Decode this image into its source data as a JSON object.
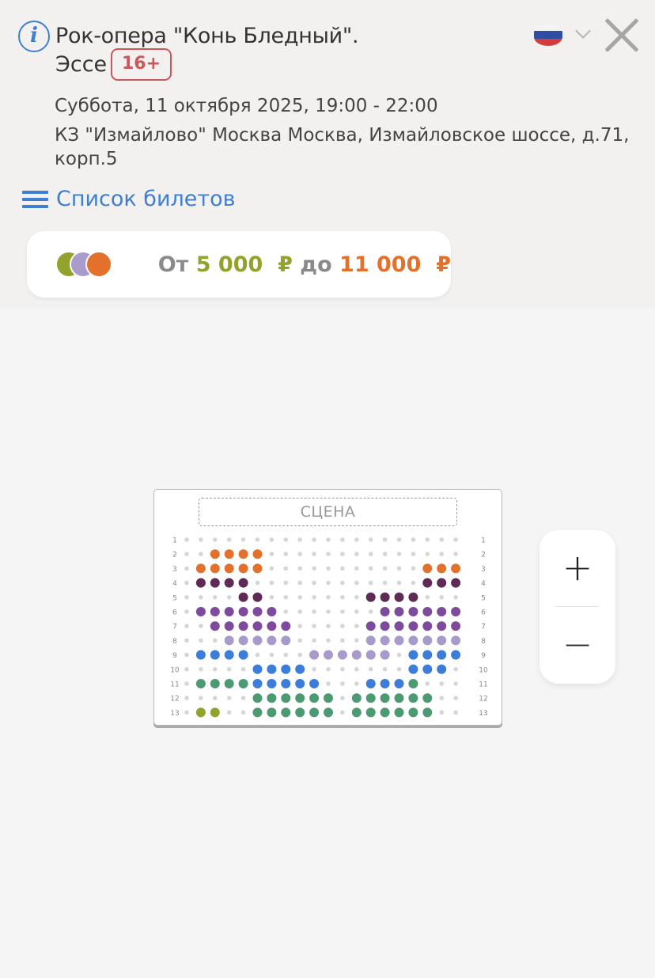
{
  "event": {
    "title_line1": "Рок-опера \"Конь Бледный\".",
    "title_line2": "Эссе",
    "age_rating": "16+",
    "datetime": "Суббота, 11 октября 2025, 19:00 - 22:00",
    "venue": "КЗ \"Измайлово\" Москва Москва, Измайловское шоссе, д.71, корп.5"
  },
  "header": {
    "language_flag": "russia-flag-icon",
    "close_icon": "close-icon",
    "info_icon": "info-icon"
  },
  "tickets_link": {
    "label": "Список билетов",
    "icon": "menu-icon"
  },
  "price_range": {
    "from_label": "От",
    "min": "5 000",
    "to_label": "до",
    "max": "11 000",
    "currency": "₽",
    "swatches": [
      "#93a22c",
      "#a99bcb",
      "#e3712c"
    ]
  },
  "seat_map": {
    "stage_label": "СЦЕНА",
    "row_labels": [
      "1",
      "2",
      "3",
      "4",
      "5",
      "6",
      "7",
      "8",
      "9",
      "10",
      "11",
      "12",
      "13"
    ],
    "colors": {
      "O": "#e3712c",
      "D": "#5f2a55",
      "P": "#7d4a9c",
      "L": "#a89bcc",
      "B": "#3b7dd8",
      "G": "#4c9a72",
      "Y": "#93a22c",
      ".": "#d6d6d6"
    },
    "rows": [
      "....................",
      "..OOOO..............",
      ".OOOOO...........OOO",
      ".DDDD............DDD",
      "....DD.......DDDD...",
      ".PPPPPP.......PPPPPP",
      "..PPPPPP.....PPPPPPP",
      "...LLLLL.....LLLLLLL",
      ".BBBB....LLLLLL.BBBB",
      ".....BBBB.......BBB.",
      ".GGGGBBBBB...BBBG...",
      ".....GGGGGG.GGGGGG..",
      ".YY..GGGGGG.GGGGGG.."
    ]
  },
  "zoom": {
    "in_label": "+",
    "out_label": "−"
  }
}
